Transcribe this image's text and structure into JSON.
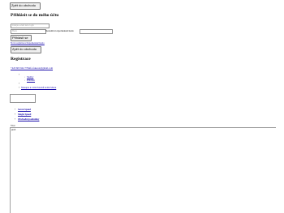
{
  "top_button": "Zpět do obchodu",
  "login": {
    "title": "Přihlásit se do mého účtu",
    "email_placeholder": "Zadejte e-mail nebo login",
    "password_placeholder": "Heslo",
    "remember_label": "Nezadávat zapomenuté heslo",
    "submit_label": "Přihlásit se",
    "links_text": "Nová registrace/Zapomenuté heslo",
    "back_button": "Zpět do obchodu"
  },
  "register": {
    "title": "Registrace",
    "contact": "+420 603 944 779info.fakeout@gmail.com"
  },
  "nav": {
    "items": [
      "Služby",
      "Přihlásit"
    ],
    "cart": "Nakupte k vám Pokoků košík Menu"
  },
  "links": [
    "Seven Speed",
    "Single Speed",
    "Obchodní podmínky"
  ],
  "footer": {
    "label_a": "Více",
    "label_b": "prež"
  }
}
